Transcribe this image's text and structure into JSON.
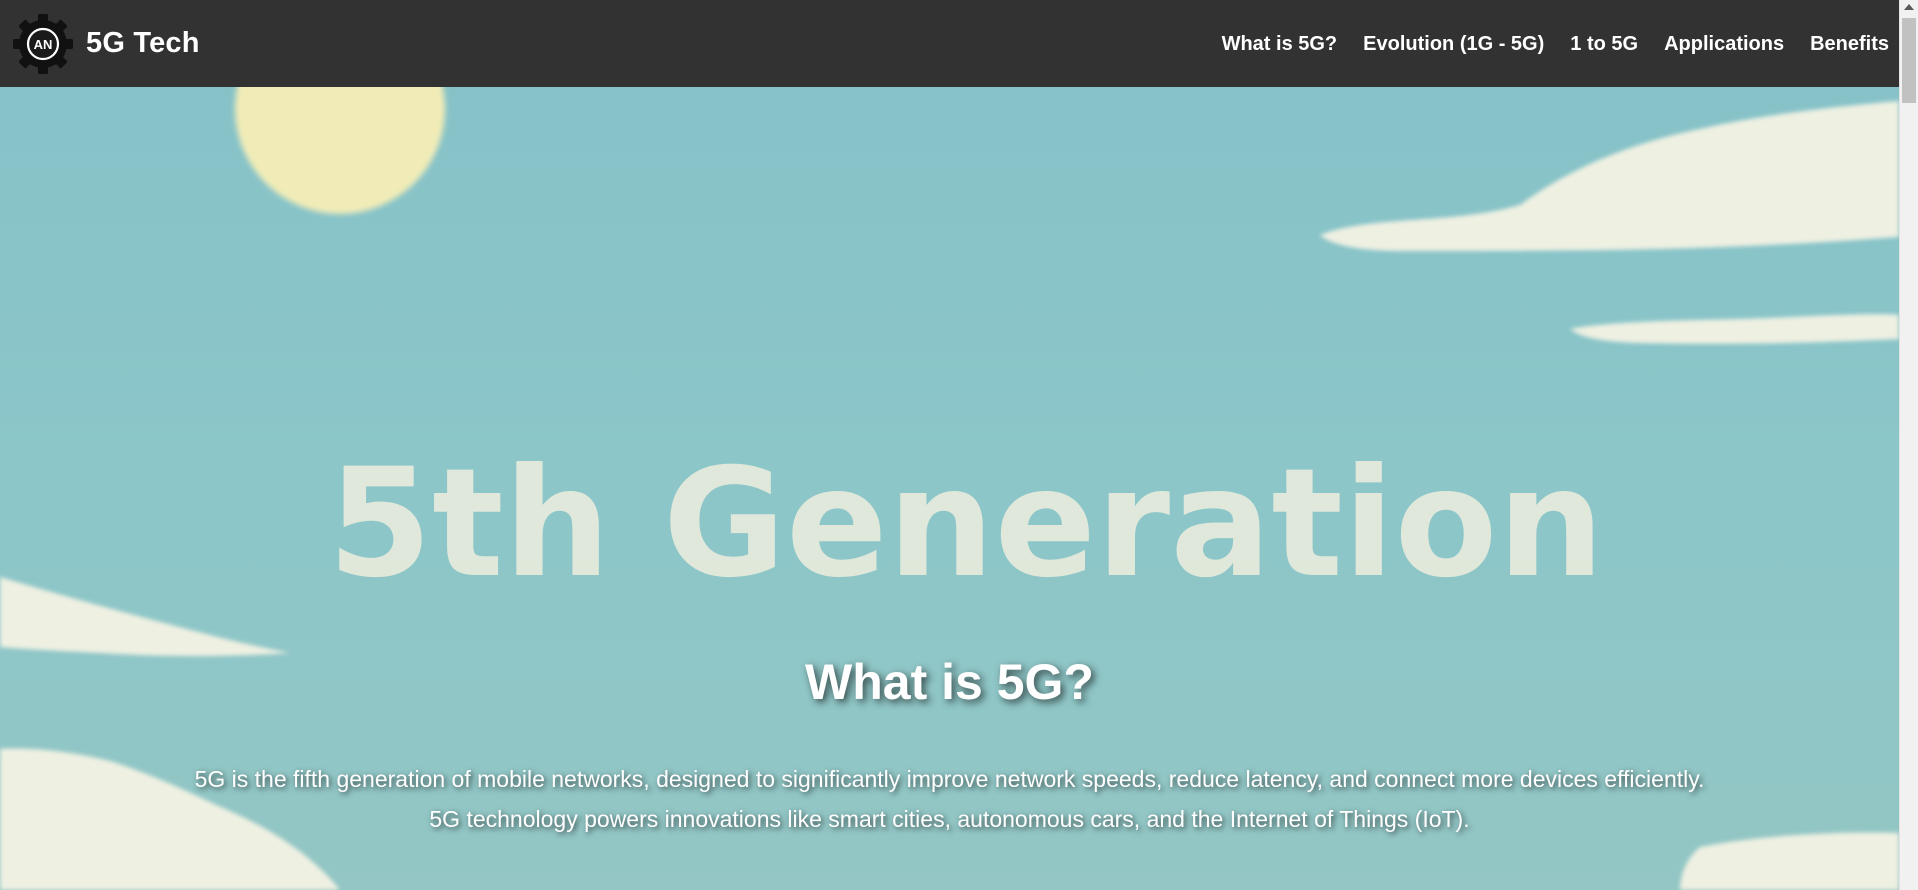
{
  "header": {
    "logo_text": "AN",
    "brand": "5G Tech",
    "nav": [
      {
        "label": "What is 5G?"
      },
      {
        "label": "Evolution (1G - 5G)"
      },
      {
        "label": "1 to 5G"
      },
      {
        "label": "Applications"
      },
      {
        "label": "Benefits"
      }
    ]
  },
  "hero": {
    "background_text": "5th Generation",
    "title": "What is 5G?",
    "description_lines": [
      "5G is the fifth generation of mobile networks, designed to significantly improve network speeds, reduce latency, and connect more devices efficiently.",
      "5G technology powers innovations like smart cities, autonomous cars, and the Internet of Things (IoT)."
    ]
  },
  "colors": {
    "header_bg": "#323232",
    "sky": "#8fc5c9",
    "cloud": "#eef0e2",
    "sun": "#f1ecb7",
    "text": "#ffffff"
  },
  "icons": {
    "logo": "gear-logo-icon",
    "scroll_up": "scroll-up-arrow-icon"
  }
}
